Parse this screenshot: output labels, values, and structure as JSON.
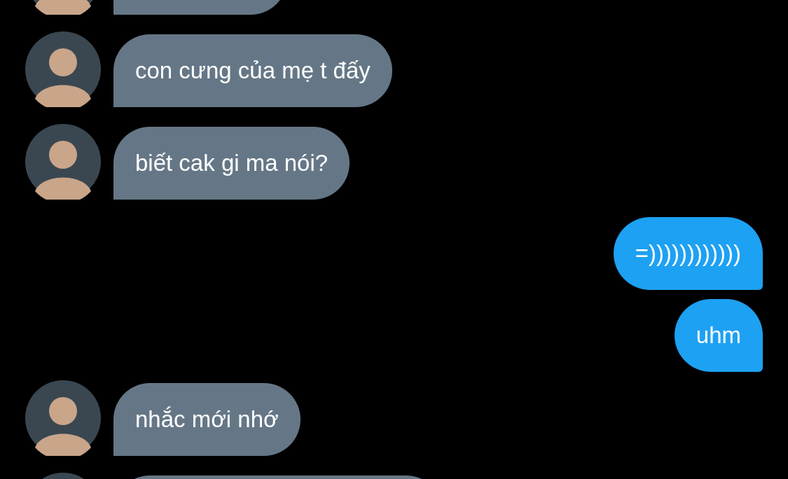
{
  "messages": [
    {
      "kind": "incoming"
    },
    {
      "kind": "incoming",
      "text": "con cưng của mẹ t đấy"
    },
    {
      "kind": "incoming",
      "text": "biết cak gi ma nói?"
    },
    {
      "kind": "outgoing",
      "text": "=))))))))))))"
    },
    {
      "kind": "outgoing",
      "text": "uhm"
    },
    {
      "kind": "incoming",
      "text": "nhắc mới nhớ"
    },
    {
      "kind": "incoming"
    }
  ]
}
